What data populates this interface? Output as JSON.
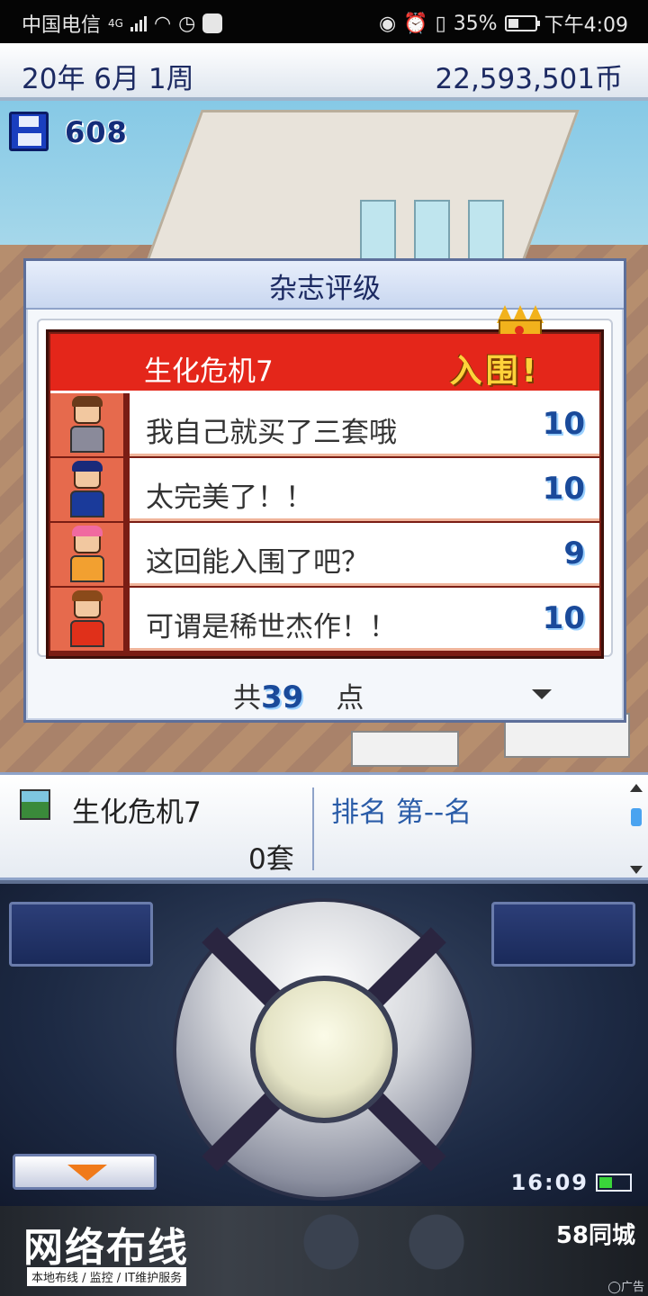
{
  "status_bar": {
    "carrier": "中国电信",
    "network": "4G",
    "battery": "35%",
    "time": "下午4:09"
  },
  "top_bar": {
    "date": "20年 6月 1周",
    "money": "22,593,501币"
  },
  "save": {
    "count": "608"
  },
  "rating_dialog": {
    "title": "杂志评级",
    "game_name": "生化危机7",
    "badge": "入围!",
    "reviews": [
      {
        "comment": "我自己就买了三套哦",
        "score": "10",
        "hair": "#6a3a1a",
        "shirt": "#8a8a9a"
      },
      {
        "comment": "太完美了！！",
        "score": "10",
        "hair": "#1a2a7a",
        "shirt": "#1a3a9a"
      },
      {
        "comment": "这回能入围了吧？",
        "score": "9",
        "hair": "#f06aa0",
        "shirt": "#f2a030"
      },
      {
        "comment": "可谓是稀世杰作！！",
        "score": "10",
        "hair": "#8a4a1a",
        "shirt": "#e0301a"
      }
    ],
    "total_prefix": "共",
    "total_value": "39",
    "total_unit": "点"
  },
  "product": {
    "name": "生化危机7",
    "quantity": "0套",
    "rank": "排名 第--名"
  },
  "controller": {
    "clock": "16:09"
  },
  "ad": {
    "title": "网络布线",
    "subtitle": "本地布线 / 监控 / IT维护服务",
    "brand": "58同城",
    "tag": "广告"
  }
}
